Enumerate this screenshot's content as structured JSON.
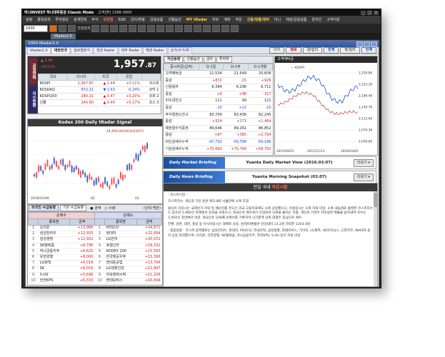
{
  "app": {
    "title": "하나INVEST 하나대투증권 Classic Mode",
    "phone": "고객센터 1588-3600",
    "window_buttons": [
      "_",
      "□",
      "x"
    ]
  },
  "menu": [
    {
      "label": "설정"
    },
    {
      "label": "종목검색"
    },
    {
      "label": "투자정보"
    },
    {
      "label": "검색연회"
    },
    {
      "label": "주식"
    },
    {
      "label": "유권점",
      "style": "red"
    },
    {
      "label": "ELW"
    },
    {
      "label": "금리/환율"
    },
    {
      "label": "금융상품"
    },
    {
      "label": "선물옵션"
    },
    {
      "label": "MY tRadar",
      "style": "yel"
    },
    {
      "label": "차트"
    },
    {
      "label": "계좌"
    },
    {
      "label": "주문"
    },
    {
      "label": "신용/대출/대여",
      "style": "yel"
    },
    {
      "label": "미니"
    },
    {
      "label": "채권/금융상품"
    },
    {
      "label": "온라인"
    },
    {
      "label": "고객지원"
    }
  ],
  "toolbar": {
    "input_value": "1000",
    "search_label": "선점검색"
  },
  "tabstrip": {
    "tab": "tRadar2.0"
  },
  "inner": {
    "title": "1000 tRadar2.0"
  },
  "subtabs": {
    "tabs": [
      "tRadar2.0",
      "대한민국",
      "글로벌분석",
      "현금 Radar",
      "대주 Radar",
      "채권 Radar",
      "상가/수가/위"
    ],
    "pills": [
      {
        "label": "다우",
        "style": ""
      },
      {
        "label": "쌍보",
        "style": "red"
      },
      {
        "label": "경/집리",
        "style": ""
      },
      {
        "label": "인계",
        "style": "blue"
      },
      {
        "label": "쌍/집리",
        "style": ""
      },
      {
        "label": "인계",
        "style": "blue"
      }
    ]
  },
  "index_box": {
    "side_top": "공정현화",
    "side_bottom": "지수현황",
    "big_value_int": "1,957",
    "big_value_dec": ".87",
    "small1": "▲ 2.44",
    "small2": "+0.11%",
    "headers": [
      "국내",
      "아시아",
      "미국",
      "유럽"
    ],
    "rows": [
      {
        "name": "KOSPI",
        "value": "1,957.87",
        "chg": "▲ 2.44",
        "pct": "+0.11%",
        "extra": "코스피",
        "dir": "up"
      },
      {
        "name": "KOSDAQ",
        "value": "672.21",
        "chg": "▼ 1.63",
        "pct": "-0.24%",
        "extra": "코닥 1",
        "dir": "dn"
      },
      {
        "name": "KOSPI200",
        "value": "240.21",
        "chg": "▲ 0.47",
        "pct": "+0.20%",
        "extra": "코피 2",
        "dir": "up"
      },
      {
        "name": "선물",
        "value": "240.60",
        "chg": "▲ 0.40",
        "pct": "+0.17%",
        "extra": "코스 3",
        "dir": "up"
      }
    ]
  },
  "signal_chart": {
    "title": "Kodex 200 Daily tRadar Signal",
    "annotation": "24,400.00(2016/03/07)",
    "x_labels": [
      "2016/01/06",
      "02",
      "03"
    ]
  },
  "investor": {
    "tabs": [
      "외국인 수급동향",
      "기관 수급동향"
    ],
    "radio1": "● 금액",
    "radio2": "○ 수량",
    "unit": "(단위:백만)",
    "buy_header": "순매수",
    "sell_header": "순매도",
    "cols": [
      "",
      "종목명",
      "금액",
      "",
      "종목명",
      "금액"
    ],
    "rows": [
      {
        "n": "1",
        "b_name": "오리온",
        "b_amt": "+13,966",
        "s_name": "POSCO",
        "s_amt": "+34,671"
      },
      {
        "n": "2",
        "b_name": "삼성전자우",
        "b_amt": "+12,933",
        "s_name": "현대차",
        "s_amt": "+22,694"
      },
      {
        "n": "3",
        "b_name": "삼성생명",
        "b_amt": "+12,922",
        "s_name": "LG전자",
        "s_amt": "+20,031"
      },
      {
        "n": "4",
        "b_name": "SK텔레콤",
        "b_amt": "+8,796",
        "s_name": "호텔신라",
        "s_amt": "+18,191"
      },
      {
        "n": "5",
        "b_name": "하나금융지주",
        "b_amt": "+8,625",
        "s_name": "KODEX 200",
        "s_amt": "+15,583"
      },
      {
        "n": "6",
        "b_name": "유한양행",
        "b_amt": "+8,000",
        "s_name": "한국항공우주",
        "s_amt": "+15,396"
      },
      {
        "n": "7",
        "b_name": "LG화학",
        "b_amt": "+6,018",
        "s_name": "현대중공업",
        "s_amt": "+13,794"
      },
      {
        "n": "8",
        "b_name": "SK",
        "b_amt": "+6,016",
        "s_name": "LG생활건강",
        "s_amt": "+12,997"
      },
      {
        "n": "9",
        "b_name": "S-Oil",
        "b_amt": "+5,696",
        "s_name": "아모레퍼시픽",
        "s_amt": "+11,206"
      },
      {
        "n": "10",
        "b_name": "한전KPS",
        "b_amt": "+5,333",
        "s_name": "현대모비스",
        "s_amt": "+10,694"
      }
    ]
  },
  "flow": {
    "tabs": [
      "자금동향",
      "선물옵션",
      "금리",
      "투자자"
    ],
    "headers": [
      "증시자금(십억)",
      "D-1일",
      "D-1주",
      "D-1개월"
    ],
    "rows": [
      {
        "name": "고객예탁금",
        "d1": "21,534",
        "w1": "21,549",
        "m1": "20,608",
        "dir": ""
      },
      {
        "name": "증감",
        "d1": "+872",
        "w1": "-15",
        "m1": "+926",
        "dir": "up"
      },
      {
        "name": "신용융자",
        "d1": "6,394",
        "w1": "6,296",
        "m1": "6,711",
        "dir": ""
      },
      {
        "name": "증감",
        "d1": "+9",
        "w1": "+98",
        "m1": "-317",
        "dir": "up"
      },
      {
        "name": "미수금잔고",
        "d1": "111",
        "w1": "99",
        "m1": "121",
        "dir": ""
      },
      {
        "name": "증감",
        "d1": "-10",
        "w1": "+12",
        "m1": "-10",
        "dir": "dn"
      },
      {
        "name": "주식형펀드잔고",
        "d1": "83,709",
        "w1": "83,436",
        "m1": "82,245",
        "dir": ""
      },
      {
        "name": "증감",
        "d1": "+324",
        "w1": "+273",
        "m1": "+1,464",
        "dir": "up"
      },
      {
        "name": "채권형수익증권",
        "d1": "89,646",
        "w1": "89,261",
        "m1": "86,852",
        "dir": ""
      },
      {
        "name": "증감",
        "d1": "+87",
        "w1": "+385",
        "m1": "+2,794",
        "dir": "up"
      },
      {
        "name": "외인순매수누적",
        "d1": "-47,732",
        "w1": "-59,768",
        "m1": "-59,196",
        "dir": "dn"
      },
      {
        "name": "기관순매수누적",
        "d1": "+70,660",
        "w1": "+75,784",
        "m1": "+58,750",
        "dir": "up"
      }
    ]
  },
  "kospi_chart": {
    "head": "고객예탁금",
    "legend": "— KOSPI",
    "y_labels": [
      "2,259.86",
      "2,223.16",
      "2,186.46",
      "2,149.76",
      "2,113.06",
      "2,076.36",
      "2,039.66"
    ],
    "x_labels": [
      "2015/09/15",
      "2015/11/11",
      "2016/03/02"
    ]
  },
  "briefs": [
    {
      "label": "Daily Market Briefing",
      "text": "Yuanta Daily Market View (2016.03.07)",
      "btn": "더보기 ▾"
    },
    {
      "label": "Daily News Briefing",
      "text": "Yuanta Morning Snapshot (03.07)",
      "btn": "더보기 ▾"
    }
  ],
  "news": {
    "head_prefix": "전일 국내 ",
    "head_highlight": "마감시황",
    "para1": "- 코스피시장 -",
    "para2": "코스피지수, 개인과 기관 동반 매도세로 사흘만에 소폭 조정.",
    "para3": "밤사이 미증시는 국제유가 하락 및 예상치를 웃도는 미국 고용지표에도 소폭 상승했으나, 유럽증시는 소폭 하락 마감. 소폭 내림세로 출발한 코스피지수는 장초반 1,960선 아래에서 등락을 보였으나, 외국인의 매수세가 유입되며 낙폭을 줄이는 흐름. 개인과 기관이 차익실현 매물을 쏟아내며 지수는 1,950선 중반에서 마감. 외국인은 닷새째 순매수를 기록하며 시가총액 상위 대형주 중심으로 매수.",
    "para4": "한편, 일본, 대만, 홍콩 등 아시아증시는 대체로 상승, 원/달러환율은 전일대비 11.2원 하락한 1203.4원.",
    "para5": "- 업종동향 - 코스피 종목별로는 삼성전자우, 현대차, POSCO, 한국전력, 삼성생명, 현대모비스, 기아차, LG화학, SK하이닉스, 신한지주, NAVER 등이 상승 마감했으며, 오리온, 유한양행, SK텔레콤, 하나금융지주, 한전KPS, S-Oil 등이 하락 마감."
  }
}
